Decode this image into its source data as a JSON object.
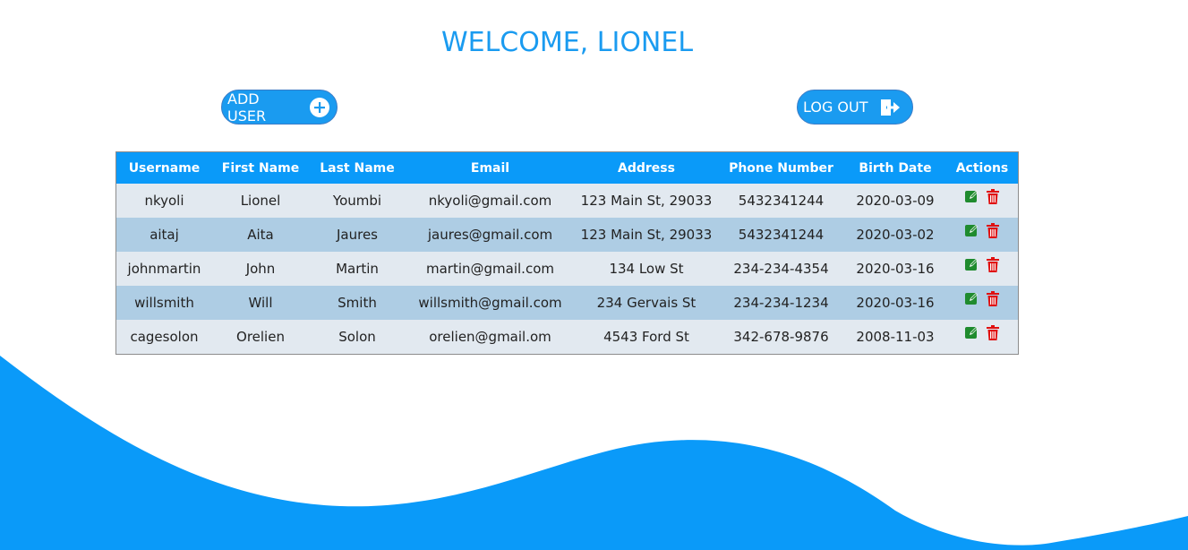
{
  "header": {
    "title": "WELCOME, LIONEL"
  },
  "toolbar": {
    "add_user_label": "ADD USER",
    "logout_label": "LOG OUT"
  },
  "table": {
    "columns": [
      "Username",
      "First Name",
      "Last Name",
      "Email",
      "Address",
      "Phone Number",
      "Birth Date",
      "Actions"
    ],
    "rows": [
      {
        "username": "nkyoli",
        "first_name": "Lionel",
        "last_name": "Youmbi",
        "email": "nkyoli@gmail.com",
        "address": "123 Main St, 29033",
        "phone": "5432341244",
        "birth_date": "2020-03-09"
      },
      {
        "username": "aitaj",
        "first_name": "Aita",
        "last_name": "Jaures",
        "email": "jaures@gmail.com",
        "address": "123 Main St, 29033",
        "phone": "5432341244",
        "birth_date": "2020-03-02"
      },
      {
        "username": "johnmartin",
        "first_name": "John",
        "last_name": "Martin",
        "email": "martin@gmail.com",
        "address": "134 Low St",
        "phone": "234-234-4354",
        "birth_date": "2020-03-16"
      },
      {
        "username": "willsmith",
        "first_name": "Will",
        "last_name": "Smith",
        "email": "willsmith@gmail.com",
        "address": "234 Gervais St",
        "phone": "234-234-1234",
        "birth_date": "2020-03-16"
      },
      {
        "username": "cagesolon",
        "first_name": "Orelien",
        "last_name": "Solon",
        "email": "orelien@gmail.om",
        "address": "4543 Ford St",
        "phone": "342-678-9876",
        "birth_date": "2008-11-03"
      }
    ]
  },
  "icons": {
    "add": "plus-circle-icon",
    "logout": "logout-icon",
    "edit": "edit-icon",
    "delete": "trash-icon"
  },
  "colors": {
    "accent": "#1a9bf0",
    "header_bg": "#0a9af9",
    "row_odd": "#e2e9f0",
    "row_even": "#aecde4",
    "edit": "#1f8b2e",
    "delete": "#e01010"
  }
}
